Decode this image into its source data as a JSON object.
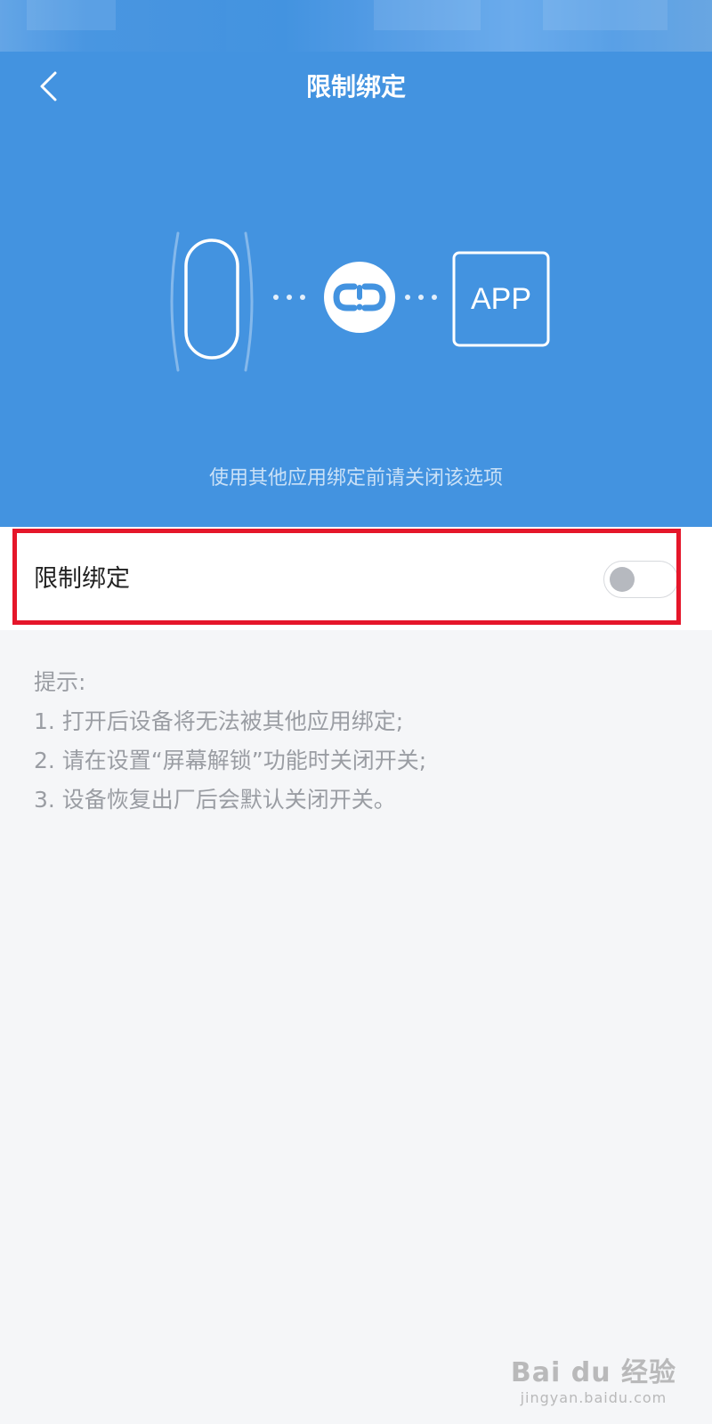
{
  "header": {
    "title": "限制绑定",
    "back_icon": "chevron-left-icon"
  },
  "illustration": {
    "device_icon": "band-icon",
    "link_icon": "broken-link-icon",
    "app_label": "APP"
  },
  "hero": {
    "caption": "使用其他应用绑定前请关闭该选项"
  },
  "setting": {
    "label": "限制绑定",
    "toggle_on": false
  },
  "tips": {
    "title": "提示:",
    "items": [
      "1. 打开后设备将无法被其他应用绑定;",
      "2. 请在设置“屏幕解锁”功能时关闭开关;",
      "3. 设备恢复出厂后会默认关闭开关。"
    ]
  },
  "watermark": {
    "main": "Bai du 经验",
    "sub": "jingyan.baidu.com"
  },
  "colors": {
    "header_bg": "#4393e0",
    "highlight_border": "#e5162a",
    "page_bg": "#f5f6f8"
  }
}
